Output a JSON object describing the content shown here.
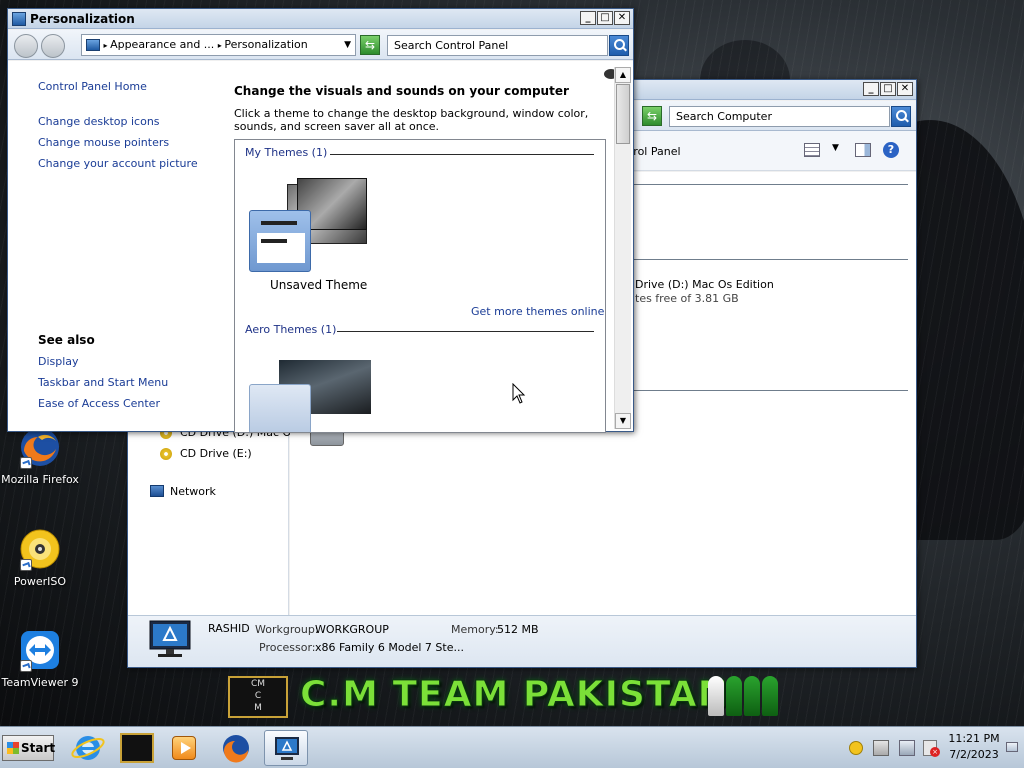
{
  "desktop": {
    "icons": [
      {
        "label": "Mozilla Firefox"
      },
      {
        "label": "PowerISO"
      },
      {
        "label": "TeamViewer 9"
      }
    ],
    "banner": {
      "logo_text": "CM\nC M",
      "text": "C.M TEAM PAKISTAN"
    }
  },
  "computer_window": {
    "search_placeholder": "Search Computer",
    "breadcrumb_partial": "ntrol Panel",
    "nav": {
      "cd_drive_d": "CD Drive (D:) Mac Os I",
      "cd_drive_e": "CD Drive (E:)",
      "network": "Network"
    },
    "drive": {
      "name": "Drive (D:) Mac Os Edition",
      "free": "tes free of 3.81 GB"
    },
    "details": {
      "computer_name": "RASHID",
      "workgroup_label": "Workgroup:",
      "workgroup_value": "WORKGROUP",
      "memory_label": "Memory:",
      "memory_value": "512 MB",
      "processor_label": "Processor:",
      "processor_value": "x86 Family 6 Model 7 Ste..."
    }
  },
  "personalization_window": {
    "title": "Personalization",
    "breadcrumb": {
      "part1": "Appearance and ...",
      "part2": "Personalization"
    },
    "search_placeholder": "Search Control Panel",
    "sidebar": {
      "home": "Control Panel Home",
      "links": [
        "Change desktop icons",
        "Change mouse pointers",
        "Change your account picture"
      ],
      "see_also_heading": "See also",
      "see_also": [
        "Display",
        "Taskbar and Start Menu",
        "Ease of Access Center"
      ]
    },
    "heading": "Change the visuals and sounds on your computer",
    "description": "Click a theme to change the desktop background, window color, sounds, and screen saver all at once.",
    "my_themes_label": "My Themes (1)",
    "unsaved_theme": "Unsaved Theme",
    "get_more_themes": "Get more themes online",
    "aero_themes_label": "Aero Themes (1)"
  },
  "taskbar": {
    "start_label": "Start",
    "time": "11:21 PM",
    "date": "7/2/2023"
  }
}
